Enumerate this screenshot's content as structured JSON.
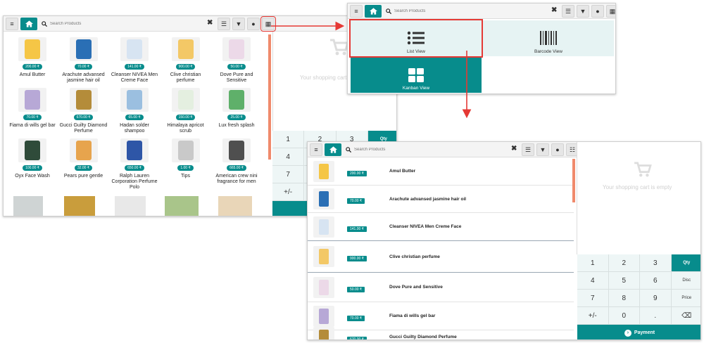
{
  "search_placeholder": "Search Products",
  "products": [
    {
      "name": "Amul Butter",
      "price": "200.00 ₹"
    },
    {
      "name": "Arachute advansed jasmine hair oil",
      "price": "70.00 ₹"
    },
    {
      "name": "Cleanser NIVEA Men Creme Face",
      "price": "141.00 ₹"
    },
    {
      "name": "Clive christian perfume",
      "price": "900.00 ₹"
    },
    {
      "name": "Dove Pure and Sensitive",
      "price": "50.00 ₹"
    },
    {
      "name": "Fiama di wills gel bar",
      "price": "70.00 ₹"
    },
    {
      "name": "Gucci Guilty Diamond Perfume",
      "price": "670.00 ₹"
    },
    {
      "name": "Hadan solder shampoo",
      "price": "65.00 ₹"
    },
    {
      "name": "Himalaya apricot scrub",
      "price": "150.00 ₹"
    },
    {
      "name": "Lux fresh splash",
      "price": "25.00 ₹"
    },
    {
      "name": "Oyx Face Wash",
      "price": "100.00 ₹"
    },
    {
      "name": "Pears pure gentle",
      "price": "32.00 ₹"
    },
    {
      "name": "Ralph Lauren Corporation Perfume Polo",
      "price": "650.00 ₹"
    },
    {
      "name": "Tips",
      "price": "1.00 ₹"
    },
    {
      "name": "American crew nini fragrance for men",
      "price": "665.00 ₹"
    }
  ],
  "list_rows": [
    {
      "name": "Amul Butter",
      "price": "200.00 ₹"
    },
    {
      "name": "Arachute advansed jasmine hair oil",
      "price": "70.00 ₹"
    },
    {
      "name": "Cleanser NIVEA Men Creme Face",
      "price": "141.00 ₹"
    },
    {
      "name": "Clive christian perfume",
      "price": "900.00 ₹"
    },
    {
      "name": "Dove Pure and Sensitive",
      "price": "50.00 ₹"
    },
    {
      "name": "Fiama di wills gel bar",
      "price": "70.00 ₹"
    },
    {
      "name": "Gucci Guilty Diamond Perfume",
      "price": "670.00 ₹"
    }
  ],
  "views": {
    "list": "List View",
    "barcode": "Barcode View",
    "kanban": "Kanban View"
  },
  "cart": {
    "empty_short": "Your shopping cart is",
    "empty_full": "Your shopping cart is empty"
  },
  "keypad": {
    "keys": [
      "1",
      "2",
      "3",
      "Qty",
      "4",
      "5",
      "6",
      "Disc",
      "7",
      "8",
      "9",
      "Price",
      "+/-",
      "0",
      ".",
      "⌫"
    ],
    "payment": "Payment"
  },
  "colors": {
    "accent": "#078c8c",
    "highlight": "#e53935"
  }
}
